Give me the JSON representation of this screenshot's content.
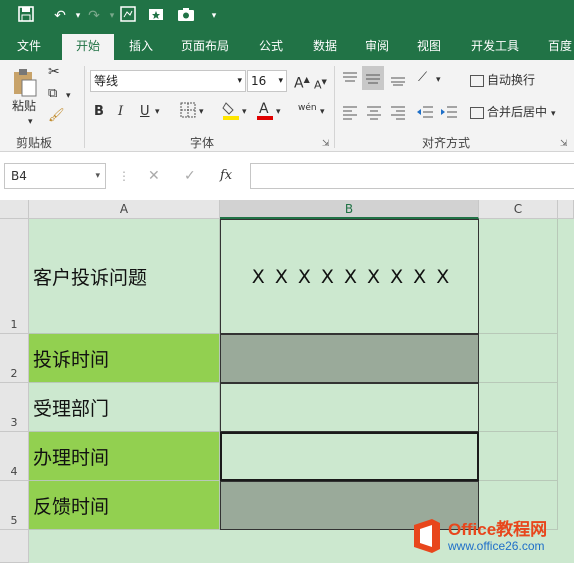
{
  "ribbon": {
    "tabs": [
      "文件",
      "开始",
      "插入",
      "页面布局",
      "公式",
      "数据",
      "审阅",
      "视图",
      "开发工具",
      "百度"
    ],
    "paste_label": "粘贴",
    "font_name": "等线",
    "font_size": "16",
    "bold": "B",
    "italic": "I",
    "underline": "U",
    "wen": "wén",
    "wrap_text": "自动换行",
    "merge_center": "合并后居中",
    "groups": {
      "clipboard": "剪贴板",
      "font": "字体",
      "align": "对齐方式"
    }
  },
  "formula_bar": {
    "name_box": "B4",
    "fx": "fx",
    "value": ""
  },
  "columns": [
    "A",
    "B",
    "C"
  ],
  "rows": [
    "1",
    "2",
    "3",
    "4",
    "5"
  ],
  "cells": {
    "A1": "客户投诉问题",
    "B1": "X X X X X X X X X",
    "A2": "投诉时间",
    "A3": "受理部门",
    "A4": "办理时间",
    "A5": "反馈时间"
  },
  "watermark": {
    "brand": "Office教程网",
    "url": "www.office26.com"
  },
  "colors": {
    "ribbon_green": "#217346",
    "sheet_bg": "#cce8cf",
    "label_green": "#92d050",
    "gray_fill": "#9aaa9a"
  }
}
